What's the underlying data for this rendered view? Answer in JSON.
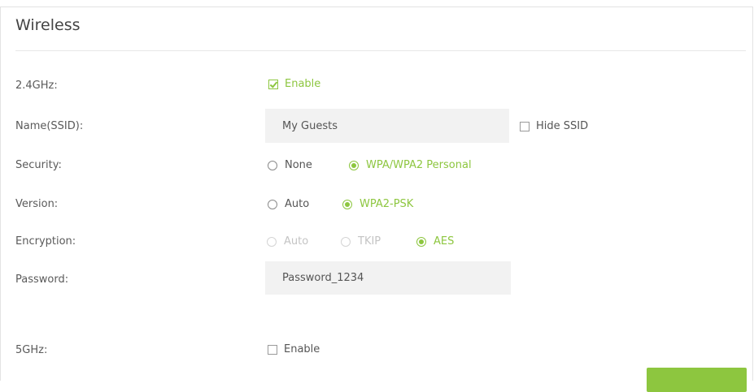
{
  "section": {
    "title": "Wireless"
  },
  "band24": {
    "label": "2.4GHz:",
    "enable_label": "Enable",
    "enabled": true
  },
  "ssid": {
    "label": "Name(SSID):",
    "value": "My Guests",
    "hide_label": "Hide SSID",
    "hidden": false
  },
  "security": {
    "label": "Security:",
    "options": [
      {
        "label": "None",
        "selected": false
      },
      {
        "label": "WPA/WPA2 Personal",
        "selected": true
      }
    ]
  },
  "version": {
    "label": "Version:",
    "options": [
      {
        "label": "Auto",
        "selected": false
      },
      {
        "label": "WPA2-PSK",
        "selected": true
      }
    ]
  },
  "encryption": {
    "label": "Encryption:",
    "options": [
      {
        "label": "Auto",
        "selected": false,
        "disabled": true
      },
      {
        "label": "TKIP",
        "selected": false,
        "disabled": true
      },
      {
        "label": "AES",
        "selected": true,
        "disabled": false
      }
    ]
  },
  "password": {
    "label": "Password:",
    "value": "Password_1234"
  },
  "band5": {
    "label": "5GHz:",
    "enable_label": "Enable",
    "enabled": false
  },
  "colors": {
    "accent": "#8dc63f",
    "text": "#555555",
    "field_bg": "#f2f2f2",
    "disabled": "#c4c4c4"
  }
}
